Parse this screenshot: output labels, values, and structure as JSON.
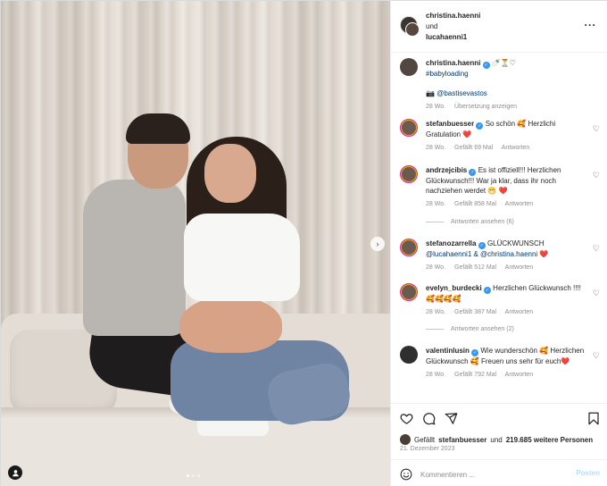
{
  "header": {
    "user1": "christina.haenni",
    "connector": "und",
    "user2": "lucahaenni1",
    "more_icon": "more-horizontal-icon"
  },
  "photo": {
    "next_icon": "chevron-right-icon",
    "user_tag_icon": "user-icon",
    "slide_count": 3,
    "active_slide": 1
  },
  "caption": {
    "username": "christina.haenni",
    "text_emoji": "🍼⏳♡",
    "hashtag": "#babyloading",
    "credit_prefix": "📷",
    "credit_handle": "@bastisevastos",
    "time": "28 Wo.",
    "translate": "Übersetzung anzeigen"
  },
  "comments": [
    {
      "username": "stefanbuesser",
      "text": "So schön 🥰 Herzlichi Gratulation ❤️",
      "time": "28 Wo.",
      "likes": "Gefällt 69 Mal",
      "reply": "Antworten"
    },
    {
      "username": "andrzejcibis",
      "text": "Es ist offiziell!!! Herzlichen Glückwunsch!!! War ja klar, dass ihr noch nachziehen werdet 😁 ❤️",
      "time": "28 Wo.",
      "likes": "Gefällt 858 Mal",
      "reply": "Antworten",
      "view_replies": "Antworten ansehen (6)"
    },
    {
      "username": "stefanozarrella",
      "text": "GLÜCKWUNSCH",
      "mentions": "@lucahaenni1 & @christina.haenni ❤️",
      "time": "28 Wo.",
      "likes": "Gefällt 512 Mal",
      "reply": "Antworten"
    },
    {
      "username": "evelyn_burdecki",
      "text": "Herzlichen Glückwunsch !!!! 🥰🥰🥰🥰",
      "time": "28 Wo.",
      "likes": "Gefällt 387 Mal",
      "reply": "Antworten",
      "view_replies": "Antworten ansehen (2)"
    },
    {
      "username": "valentinlusin",
      "text": "Wie wunderschön 🥰 Herzlichen Glückwunsch 🥰 Freuen uns sehr für euch❤️",
      "time": "28 Wo.",
      "likes": "Gefällt 792 Mal",
      "reply": "Antworten"
    }
  ],
  "actions": {
    "like_icon": "heart-icon",
    "comment_icon": "comment-icon",
    "share_icon": "send-icon",
    "save_icon": "bookmark-icon",
    "liked_prefix": "Gefällt",
    "liked_by": "stefanbuesser",
    "liked_suffix": "und",
    "liked_others": "219.685 weitere Personen",
    "date": "21. Dezember 2023"
  },
  "composer": {
    "emoji_icon": "smile-icon",
    "placeholder": "Kommentieren ...",
    "post_label": "Posten"
  },
  "colors": {
    "verified": "#3897f0",
    "link": "#00376b",
    "muted": "#8e8e8e",
    "post_disabled": "#b2dffc"
  }
}
